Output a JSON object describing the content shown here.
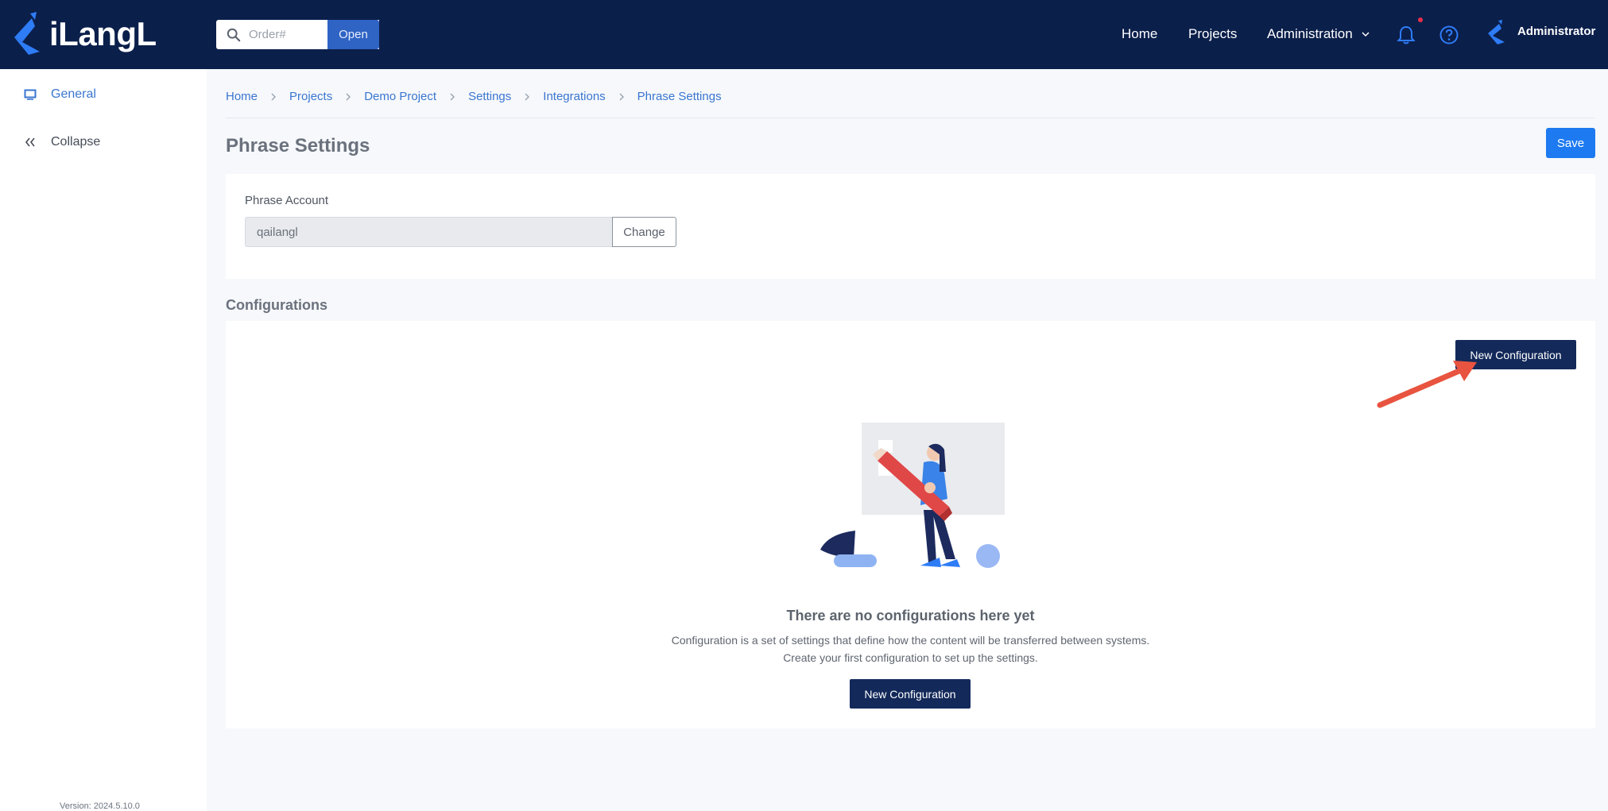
{
  "app": {
    "logo_text": "iLangL",
    "search": {
      "placeholder": "Order#",
      "value": ""
    },
    "open_label": "Open",
    "nav": {
      "home": "Home",
      "projects": "Projects",
      "administration": "Administration"
    },
    "user": "Administrator"
  },
  "sidebar": {
    "items": [
      {
        "label": "General",
        "icon": "monitor-icon"
      },
      {
        "label": "Collapse",
        "icon": "double-chevron-left-icon"
      }
    ],
    "version": "Version: 2024.5.10.0"
  },
  "breadcrumb": [
    "Home",
    "Projects",
    "Demo Project",
    "Settings",
    "Integrations",
    "Phrase Settings"
  ],
  "page": {
    "title": "Phrase Settings",
    "save_label": "Save",
    "account": {
      "label": "Phrase Account",
      "value": "qailangl",
      "change_label": "Change"
    },
    "configurations": {
      "title": "Configurations",
      "new_label": "New Configuration",
      "empty_title": "There are no configurations here yet",
      "empty_line1": "Configuration is a set of settings that define how the content will be transferred between systems.",
      "empty_line2": "Create your first configuration to set up the settings."
    }
  },
  "colors": {
    "topbar": "#0b1f4b",
    "primary": "#1d7af0",
    "dark_button": "#13295a",
    "link": "#3a76d0",
    "annotation_arrow": "#e8543f",
    "notification_dot": "#e8304a"
  }
}
